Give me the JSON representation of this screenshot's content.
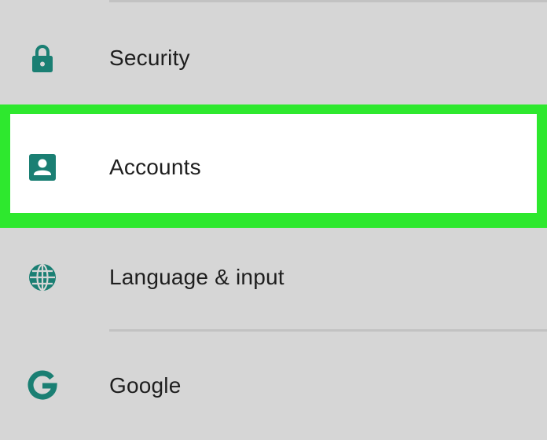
{
  "settings": {
    "items": [
      {
        "label": "Security",
        "icon": "lock-icon"
      },
      {
        "label": "Accounts",
        "icon": "account-box-icon",
        "highlighted": true
      },
      {
        "label": "Language & input",
        "icon": "globe-icon"
      },
      {
        "label": "Google",
        "icon": "google-g-icon"
      }
    ]
  },
  "colors": {
    "background": "#d6d6d6",
    "icon": "#1a7f73",
    "highlight": "#2ee82e",
    "divider": "#c2c2c2",
    "text": "#1e1e1e"
  }
}
